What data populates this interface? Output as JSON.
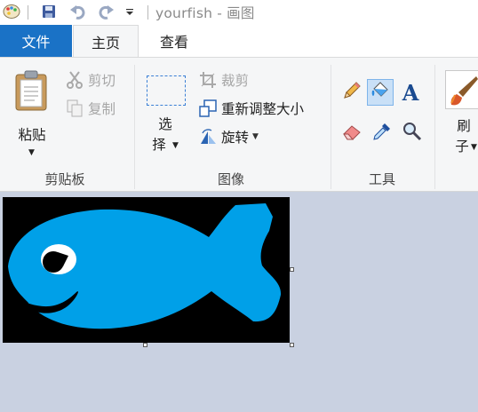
{
  "window": {
    "title": "yourfish - 画图"
  },
  "tabs": {
    "file": "文件",
    "home": "主页",
    "view": "查看"
  },
  "clipboard": {
    "paste_label": "粘贴",
    "cut_label": "剪切",
    "copy_label": "复制",
    "group_label": "剪贴板"
  },
  "image": {
    "select_line1": "选",
    "select_line2": "择",
    "crop_label": "裁剪",
    "resize_label": "重新调整大小",
    "rotate_label": "旋转",
    "group_label": "图像"
  },
  "tools": {
    "group_label": "工具",
    "text_glyph": "A"
  },
  "brushes": {
    "label_line1": "刷",
    "label_line2": "子"
  },
  "colors": {
    "accent": "#1a72c6",
    "fish": "#00a0e8",
    "canvas_bg": "#000000"
  }
}
